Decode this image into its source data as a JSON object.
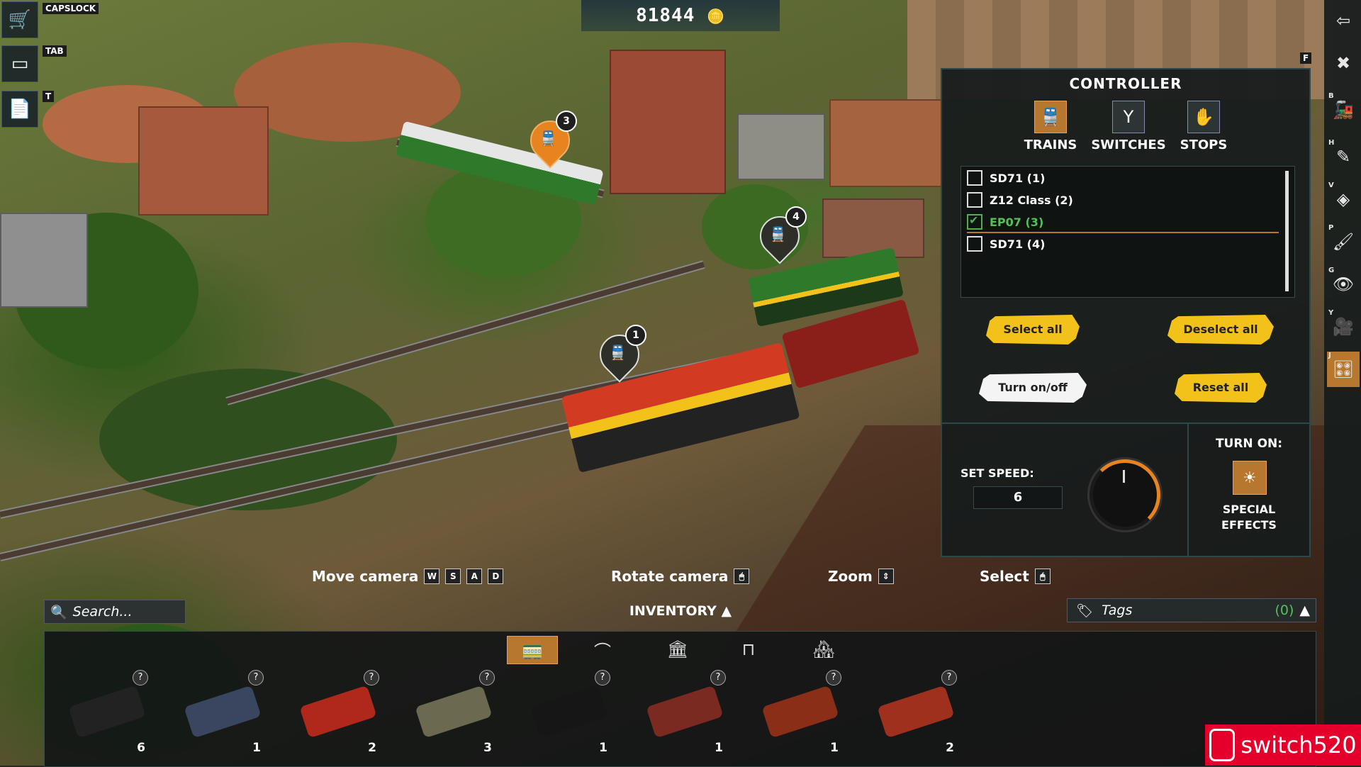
{
  "hud": {
    "currency": "81844",
    "coin_icon": "coin-stack-icon",
    "capslock_key": "CAPSLOCK",
    "tab_key": "TAB",
    "t_key": "T",
    "f_key": "F"
  },
  "left_icons": [
    "cart-icon",
    "screen-icon",
    "document-icon"
  ],
  "right_tools": [
    {
      "key": "",
      "icon": "exit-icon"
    },
    {
      "key": "",
      "icon": "tools-icon"
    },
    {
      "key": "B",
      "icon": "train-build-icon"
    },
    {
      "key": "H",
      "icon": "eyedropper-icon"
    },
    {
      "key": "V",
      "icon": "layers-icon"
    },
    {
      "key": "P",
      "icon": "paint-brush-icon"
    },
    {
      "key": "G",
      "icon": "visibility-grid-icon"
    },
    {
      "key": "Y",
      "icon": "camera-icon"
    },
    {
      "key": "J",
      "icon": "controller-icon"
    }
  ],
  "controller": {
    "title": "CONTROLLER",
    "tabs": [
      {
        "label": "TRAINS",
        "icon": "train-icon",
        "active": true
      },
      {
        "label": "SWITCHES",
        "icon": "switch-icon",
        "active": false
      },
      {
        "label": "STOPS",
        "icon": "hand-icon",
        "active": false
      }
    ],
    "trains": [
      {
        "label": "SD71 (1)",
        "checked": false
      },
      {
        "label": "Z12 Class (2)",
        "checked": false
      },
      {
        "label": "EP07 (3)",
        "checked": true
      },
      {
        "label": "SD71 (4)",
        "checked": false
      }
    ],
    "select_all": "Select all",
    "deselect_all": "Deselect all",
    "turn_on_off": "Turn on/off",
    "reset_all": "Reset all",
    "set_speed_label": "SET SPEED:",
    "speed_value": "6",
    "turn_on_label": "TURN ON:",
    "special_effects": "SPECIAL EFFECTS",
    "accent": "#f2c21b"
  },
  "hints": [
    {
      "label": "Move camera",
      "keys": [
        "W",
        "S",
        "A",
        "D"
      ]
    },
    {
      "label": "Rotate camera",
      "keys": [
        "🖱"
      ]
    },
    {
      "label": "Zoom",
      "keys": [
        "⇕"
      ]
    },
    {
      "label": "Select",
      "keys": [
        "🖱"
      ]
    }
  ],
  "inventory": {
    "search_placeholder": "Search...",
    "title": "INVENTORY",
    "tags_label": "Tags",
    "tags_count": "(0)",
    "categories": [
      "train-car-icon",
      "track-icon",
      "building-icon",
      "bench-icon",
      "scenery-icon"
    ],
    "items": [
      {
        "count": "6",
        "color": "#222222"
      },
      {
        "count": "1",
        "color": "#3a4660"
      },
      {
        "count": "2",
        "color": "#b0281c"
      },
      {
        "count": "3",
        "color": "#6b6a50"
      },
      {
        "count": "1",
        "color": "#161616"
      },
      {
        "count": "1",
        "color": "#7a2a20"
      },
      {
        "count": "1",
        "color": "#8a2e18"
      },
      {
        "count": "2",
        "color": "#a0301e"
      }
    ]
  },
  "map_pins": [
    {
      "num": "3",
      "style": "orange"
    },
    {
      "num": "4",
      "style": "dark"
    },
    {
      "num": "1",
      "style": "dark"
    }
  ],
  "watermark": "switch520"
}
